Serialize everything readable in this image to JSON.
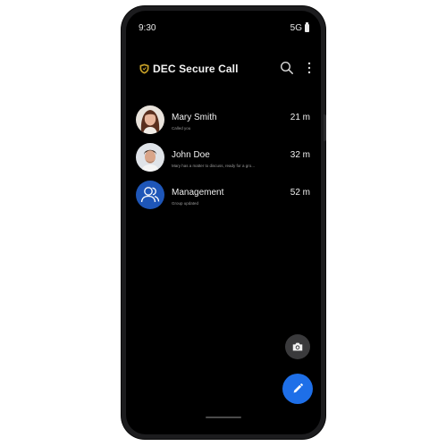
{
  "status_bar": {
    "time": "9:30",
    "network": "5G"
  },
  "app_bar": {
    "title": "DEC Secure Call"
  },
  "conversations": [
    {
      "name": "Mary Smith",
      "preview": "Called you",
      "time": "21 m",
      "avatar": "photo"
    },
    {
      "name": "John Doe",
      "preview": "Mary has a matter to discuss, ready for a gro...",
      "time": "32 m",
      "avatar": "photo"
    },
    {
      "name": "Management",
      "preview": "Group updated",
      "time": "52 m",
      "avatar": "group-icon"
    }
  ],
  "colors": {
    "accent": "#1e6fe8",
    "group_avatar": "#1e56b8",
    "logo_gold": "#c9a227",
    "background": "#000000"
  }
}
